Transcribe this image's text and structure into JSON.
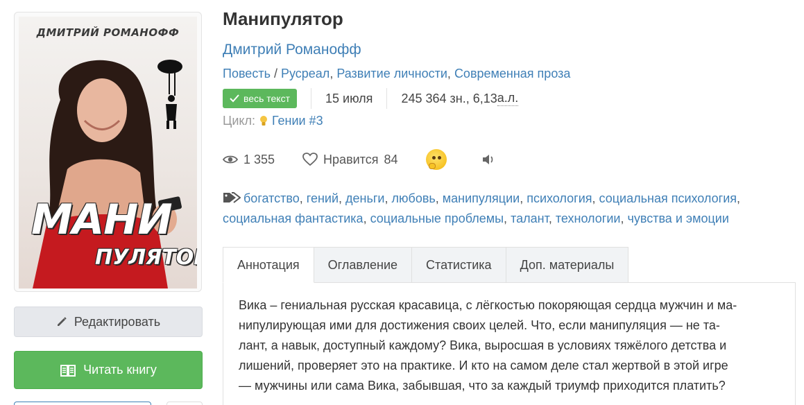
{
  "book": {
    "title": "Манипулятор",
    "author": "Дмитрий Романофф",
    "genres": [
      "Повесть",
      "Русреал",
      "Развитие личности",
      "Современная проза"
    ],
    "status_badge": "весь текст",
    "date": "15 июля",
    "size_prefix": "245 364 зн., 6,13 ",
    "size_unit": "а.л.",
    "cycle_label": "Цикл:",
    "cycle_name": "Гении #3"
  },
  "cover": {
    "author_text": "ДМИТРИЙ РОМАНОФФ",
    "title_line1": "МАНИ",
    "title_line2": "ПУЛЯТОР"
  },
  "stats": {
    "views": "1 355",
    "likes_label": "Нравится",
    "likes_count": "84"
  },
  "tags": [
    "богатство",
    "гений",
    "деньги",
    "любовь",
    "манипуляции",
    "психология",
    "социальная психология",
    "социальная фантастика",
    "социальные проблемы",
    "талант",
    "технологии",
    "чувства и эмоции"
  ],
  "tabs": [
    "Аннотация",
    "Оглавление",
    "Статистика",
    "Доп. материалы"
  ],
  "annotation": [
    "Вика – гениальная русская красавица, с лёгкостью покоряющая сердца мужчин и ма-",
    "нипулирующая ими для достижения своих целей. Что, если манипуляция — не та-",
    "лант, а навык, доступный каждому? Вика, выросшая в условиях тяжёлого детства и",
    "лишений, проверяет это на практике. И кто на самом деле стал жертвой в этой игре",
    "— мужчины или сама Вика, забывшая, что за каждый триумф приходится платить?"
  ],
  "buttons": {
    "edit": "Редактировать",
    "read": "Читать книгу"
  },
  "colors": {
    "link": "#3f7fb6",
    "green": "#5cb85c",
    "muted": "#999999"
  },
  "icons": [
    "pencil-icon",
    "book-icon",
    "eye-icon",
    "heart-icon",
    "thinking-emoji-icon",
    "speaker-icon",
    "tag-icon",
    "check-icon",
    "lightbulb-icon"
  ]
}
